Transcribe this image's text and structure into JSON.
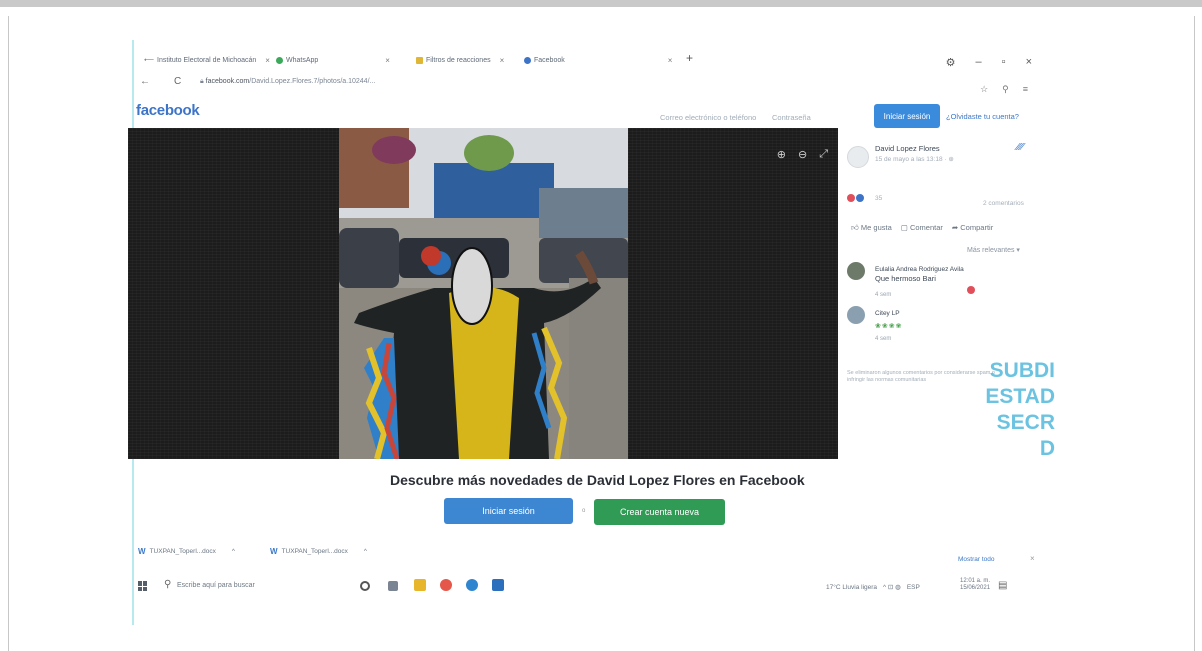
{
  "browser": {
    "tabs": [
      {
        "label": "Instituto Electoral de Michoacán",
        "close": "×"
      },
      {
        "label": "WhatsApp",
        "close": "×"
      },
      {
        "label": "Filtros de reacciones",
        "close": "×"
      },
      {
        "label": "Facebook",
        "close": "×"
      }
    ],
    "new_tab": "+",
    "window_controls": [
      "–",
      "▫",
      "×"
    ],
    "nav": {
      "back": "←",
      "reload": "C"
    },
    "url_host": "facebook.com",
    "url_path": "/David.Lopez.Flores.7/photos/a.10244/...",
    "nav_right": [
      "☆",
      "⚲",
      "≡"
    ]
  },
  "facebook": {
    "logo": "facebook",
    "header_links": [
      "Correo electrónico o teléfono",
      "Contraseña"
    ],
    "login_button": "Iniciar sesión",
    "forgot_link": "¿Olvidaste tu cuenta?"
  },
  "viewer": {
    "icons": [
      "⊕",
      "⊖",
      "⤢"
    ]
  },
  "post": {
    "author": "David Lopez Flores",
    "meta": "15 de mayo a las 13:18 · ⊕",
    "reactions": "35",
    "comments_count": "2 comentarios",
    "actions": [
      "Me gusta",
      "Comentar",
      "Compartir"
    ],
    "sort": "Más relevantes ▾",
    "comments": [
      {
        "name": "Eulalia Andrea Rodriguez Avila",
        "text": "Que hermoso Bari",
        "time": "4 sem"
      },
      {
        "name": "Citey LP",
        "text": "",
        "time": "4 sem"
      }
    ],
    "emoji_row": "❀❀❀❀",
    "footnote": "Se eliminaron algunos comentarios por considerarse spam o infringir las normas comunitarias"
  },
  "stamp": [
    "SUBDI",
    "ESTAD",
    "SECR",
    "D"
  ],
  "cta": {
    "title": "Descubre más novedades de David Lopez Flores en Facebook",
    "login": "Iniciar sesión",
    "create": "Crear cuenta nueva",
    "separator": "o"
  },
  "downloads": [
    {
      "icon": "W",
      "label": "TUXPAN_Toperl...docx",
      "chev": "^"
    },
    {
      "icon": "W",
      "label": "TUXPAN_Toperl...docx",
      "chev": "^"
    }
  ],
  "downloads_show_all": "Mostrar todo",
  "downloads_close": "×",
  "taskbar": {
    "search": "Escribe aquí para buscar",
    "weather": "17°C  Lluvia ligera",
    "tray_icons": "^ ⊡ ◍ ",
    "lang": "ESP",
    "time": "12:01 a. m.",
    "date": "15/06/2021",
    "notif": "▤"
  },
  "colors": {
    "fb_blue": "#3d74c8",
    "login_blue": "#3d86d2",
    "create_green": "#2f9b55",
    "stamp_cyan": "#52b9dc"
  }
}
